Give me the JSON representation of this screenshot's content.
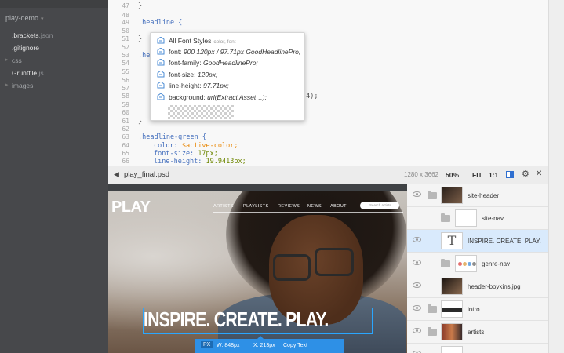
{
  "sidebar": {
    "project": "play-demo",
    "items": [
      {
        "label": ".brackets",
        "muted": ".json"
      },
      {
        "label": ".gitignore",
        "muted": ""
      },
      {
        "label": "css",
        "muted": ""
      },
      {
        "label": "Gruntfile",
        "muted": ".js"
      },
      {
        "label": "images",
        "muted": ""
      }
    ]
  },
  "editor": {
    "lines": [
      {
        "n": "47",
        "text": "}"
      },
      {
        "n": "48",
        "text": ""
      },
      {
        "n": "49",
        "text": ".headline {"
      },
      {
        "n": "50",
        "text": ""
      },
      {
        "n": "51",
        "text": "}"
      },
      {
        "n": "52",
        "text": ".he"
      },
      {
        "n": "53",
        "text": ""
      },
      {
        "n": "54",
        "text": ""
      },
      {
        "n": "55",
        "text": ""
      },
      {
        "n": "56",
        "text": ""
      },
      {
        "n": "57",
        "text": ""
      },
      {
        "n": "58",
        "text": ".4);"
      },
      {
        "n": "59",
        "text": ""
      },
      {
        "n": "60",
        "text": ""
      },
      {
        "n": "61",
        "text": "}"
      },
      {
        "n": "62",
        "text": ""
      },
      {
        "n": "63",
        "text": ".headline-green {"
      },
      {
        "n": "64",
        "text": "color: $active-color;"
      },
      {
        "n": "65",
        "text": "font-size: 17px;"
      },
      {
        "n": "66",
        "text": "line-height: 19.9413px;"
      }
    ]
  },
  "hint": {
    "rows": [
      {
        "label": "All Font Styles",
        "value": "",
        "sub": "color, font"
      },
      {
        "label": "font:",
        "value": "900 120px / 97.71px GoodHeadlinePro;",
        "sub": ""
      },
      {
        "label": "font-family:",
        "value": "GoodHeadlinePro;",
        "sub": ""
      },
      {
        "label": "font-size:",
        "value": "120px;",
        "sub": ""
      },
      {
        "label": "line-height:",
        "value": "97.71px;",
        "sub": ""
      },
      {
        "label": "background:",
        "value": "url(Extract Asset…);",
        "sub": ""
      }
    ]
  },
  "panel": {
    "filename": "play_final.psd",
    "dimensions": "1280 x 3662",
    "zoom": "50%",
    "fit": "FIT",
    "one_to_one": "1:1"
  },
  "psd": {
    "logo": "PLAY",
    "nav": [
      "ARTISTS",
      "PLAYLISTS",
      "REVIEWS",
      "NEWS",
      "ABOUT"
    ],
    "search_placeholder": "Search artists",
    "headline": "INSPIRE. CREATE. PLAY.",
    "measure": {
      "unit": "PX",
      "width": "W: 848px",
      "x": "X: 213px",
      "copy": "Copy Text"
    }
  },
  "layers": [
    {
      "name": "site-header",
      "indent": 0,
      "thumb": "photo"
    },
    {
      "name": "site-nav",
      "indent": 1,
      "thumb": "white"
    },
    {
      "name": "INSPIRE. CREATE. PLAY.",
      "indent": 1,
      "thumb": "text",
      "selected": true
    },
    {
      "name": "genre-nav",
      "indent": 1,
      "thumb": "dots"
    },
    {
      "name": "header-boykins.jpg",
      "indent": 1,
      "thumb": "photo"
    },
    {
      "name": "intro",
      "indent": 0,
      "thumb": "dark"
    },
    {
      "name": "artists",
      "indent": 0,
      "thumb": "photo2"
    },
    {
      "name": "",
      "indent": 0,
      "thumb": "white"
    }
  ],
  "colors": {
    "sidebar_bg": "#47484b",
    "editor_bg": "#f8f8f8",
    "selector": "#446fbd",
    "variable": "#e88501",
    "number": "#6d8600",
    "accent": "#2e90e6"
  }
}
